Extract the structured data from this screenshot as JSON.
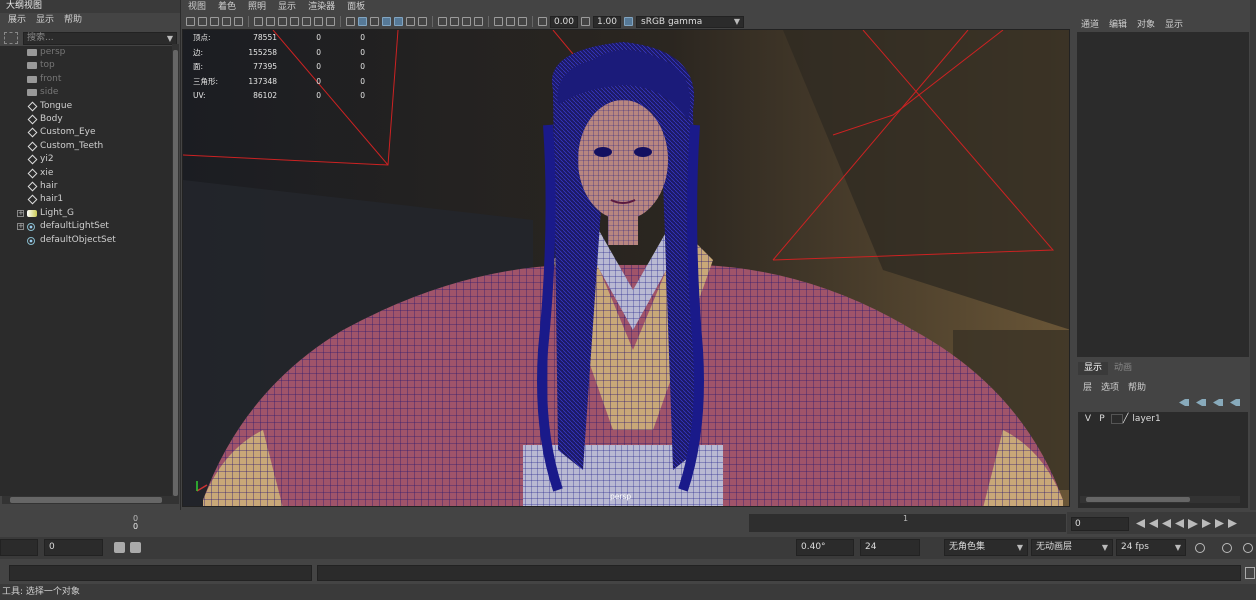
{
  "outliner": {
    "title": "大纲视图",
    "menu": [
      "展示",
      "显示",
      "帮助"
    ],
    "search_placeholder": "搜索...",
    "items": [
      {
        "label": "persp",
        "type": "camera",
        "dim": true,
        "expand": ""
      },
      {
        "label": "top",
        "type": "camera",
        "dim": true,
        "expand": ""
      },
      {
        "label": "front",
        "type": "camera",
        "dim": true,
        "expand": ""
      },
      {
        "label": "side",
        "type": "camera",
        "dim": true,
        "expand": ""
      },
      {
        "label": "Tongue",
        "type": "mesh",
        "dim": false,
        "expand": ""
      },
      {
        "label": "Body",
        "type": "mesh",
        "dim": false,
        "expand": ""
      },
      {
        "label": "Custom_Eye",
        "type": "mesh",
        "dim": false,
        "expand": ""
      },
      {
        "label": "Custom_Teeth",
        "type": "mesh",
        "dim": false,
        "expand": ""
      },
      {
        "label": "yi2",
        "type": "mesh",
        "dim": false,
        "expand": ""
      },
      {
        "label": "xie",
        "type": "mesh",
        "dim": false,
        "expand": ""
      },
      {
        "label": "hair",
        "type": "mesh",
        "dim": false,
        "expand": ""
      },
      {
        "label": "hair1",
        "type": "mesh",
        "dim": false,
        "expand": ""
      },
      {
        "label": "Light_G",
        "type": "light",
        "dim": false,
        "expand": "+"
      },
      {
        "label": "defaultLightSet",
        "type": "set",
        "dim": false,
        "expand": "+"
      },
      {
        "label": "defaultObjectSet",
        "type": "set",
        "dim": false,
        "expand": ""
      }
    ]
  },
  "viewport": {
    "menu": [
      "视图",
      "着色",
      "照明",
      "显示",
      "渲染器",
      "面板"
    ],
    "exposure": "0.00",
    "gamma": "1.00",
    "color_space": "sRGB gamma",
    "camera_label": "persp",
    "hud": [
      {
        "key": "顶点:",
        "value": "78551",
        "c1": "0",
        "c2": "0"
      },
      {
        "key": "边:",
        "value": "155258",
        "c1": "0",
        "c2": "0"
      },
      {
        "key": "面:",
        "value": "77395",
        "c1": "0",
        "c2": "0"
      },
      {
        "key": "三角形:",
        "value": "137348",
        "c1": "0",
        "c2": "0"
      },
      {
        "key": "UV:",
        "value": "86102",
        "c1": "0",
        "c2": "0"
      }
    ]
  },
  "channel_box": {
    "menu": [
      "通道",
      "编辑",
      "对象",
      "显示"
    ]
  },
  "layer_editor": {
    "tabs": [
      {
        "label": "显示",
        "active": true
      },
      {
        "label": "动画",
        "active": false
      }
    ],
    "menu": [
      "层",
      "选项",
      "帮助"
    ],
    "layers": [
      {
        "visible": "V",
        "playback": "P",
        "name": "layer1"
      }
    ]
  },
  "time_slider": {
    "start_tick": "0",
    "current": "0",
    "range_tick": "1",
    "current_frame": "0"
  },
  "range_bar": {
    "start_field": "",
    "start_value": "0",
    "end_value": "0.40°",
    "end_range": "24",
    "character_set": "无角色集",
    "anim_layer": "无动画层",
    "fps": "24 fps"
  },
  "help_line": "工具: 选择一个对象",
  "colors": {
    "panel_bg": "#444444",
    "field_bg": "#2b2b2b",
    "wireframe": "#1a1aa0",
    "camera_lines": "#cc2222",
    "highlight": "#5a83a6"
  }
}
